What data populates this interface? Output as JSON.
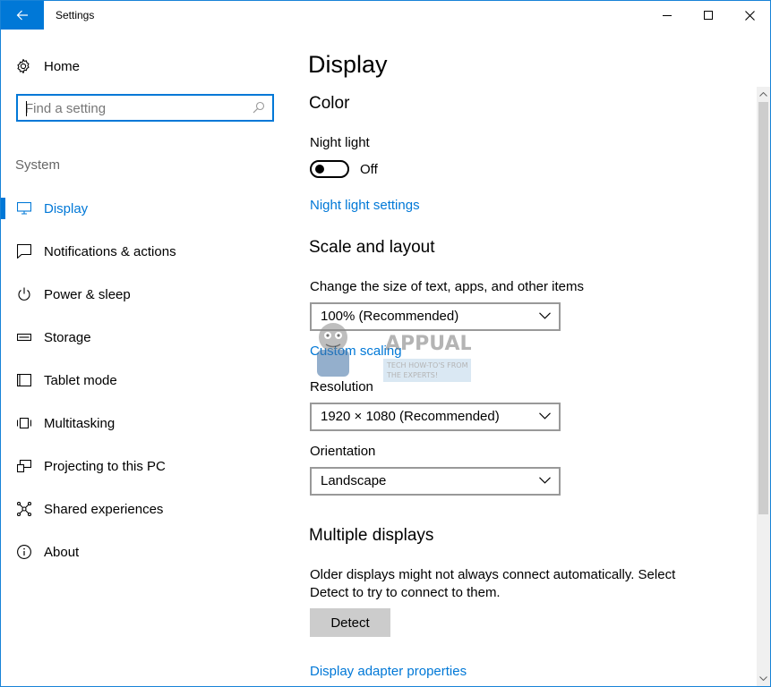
{
  "window": {
    "title": "Settings"
  },
  "sidebar": {
    "home_label": "Home",
    "search_placeholder": "Find a setting",
    "section_label": "System",
    "items": [
      {
        "label": "Display",
        "icon": "monitor-icon",
        "active": true
      },
      {
        "label": "Notifications & actions",
        "icon": "notification-icon",
        "active": false
      },
      {
        "label": "Power & sleep",
        "icon": "power-icon",
        "active": false
      },
      {
        "label": "Storage",
        "icon": "storage-icon",
        "active": false
      },
      {
        "label": "Tablet mode",
        "icon": "tablet-icon",
        "active": false
      },
      {
        "label": "Multitasking",
        "icon": "multitasking-icon",
        "active": false
      },
      {
        "label": "Projecting to this PC",
        "icon": "projecting-icon",
        "active": false
      },
      {
        "label": "Shared experiences",
        "icon": "shared-icon",
        "active": false
      },
      {
        "label": "About",
        "icon": "info-icon",
        "active": false
      }
    ]
  },
  "main": {
    "title": "Display",
    "color": {
      "heading": "Color",
      "night_light_label": "Night light",
      "night_light_state": "Off",
      "night_light_settings_link": "Night light settings"
    },
    "scale": {
      "heading": "Scale and layout",
      "size_label": "Change the size of text, apps, and other items",
      "size_value": "100% (Recommended)",
      "custom_scaling_link": "Custom scaling",
      "resolution_label": "Resolution",
      "resolution_value": "1920 × 1080 (Recommended)",
      "orientation_label": "Orientation",
      "orientation_value": "Landscape"
    },
    "multiple": {
      "heading": "Multiple displays",
      "desc_line1": "Older displays might not always connect automatically. Select",
      "desc_line2": "Detect to try to connect to them.",
      "detect_label": "Detect",
      "adapter_link": "Display adapter properties"
    }
  },
  "watermark": {
    "brand": "APPUALS",
    "tagline_line1": "TECH HOW-TO'S FROM",
    "tagline_line2": "THE EXPERTS!"
  },
  "colors": {
    "accent": "#0078d7",
    "button_gray": "#cccccc"
  }
}
